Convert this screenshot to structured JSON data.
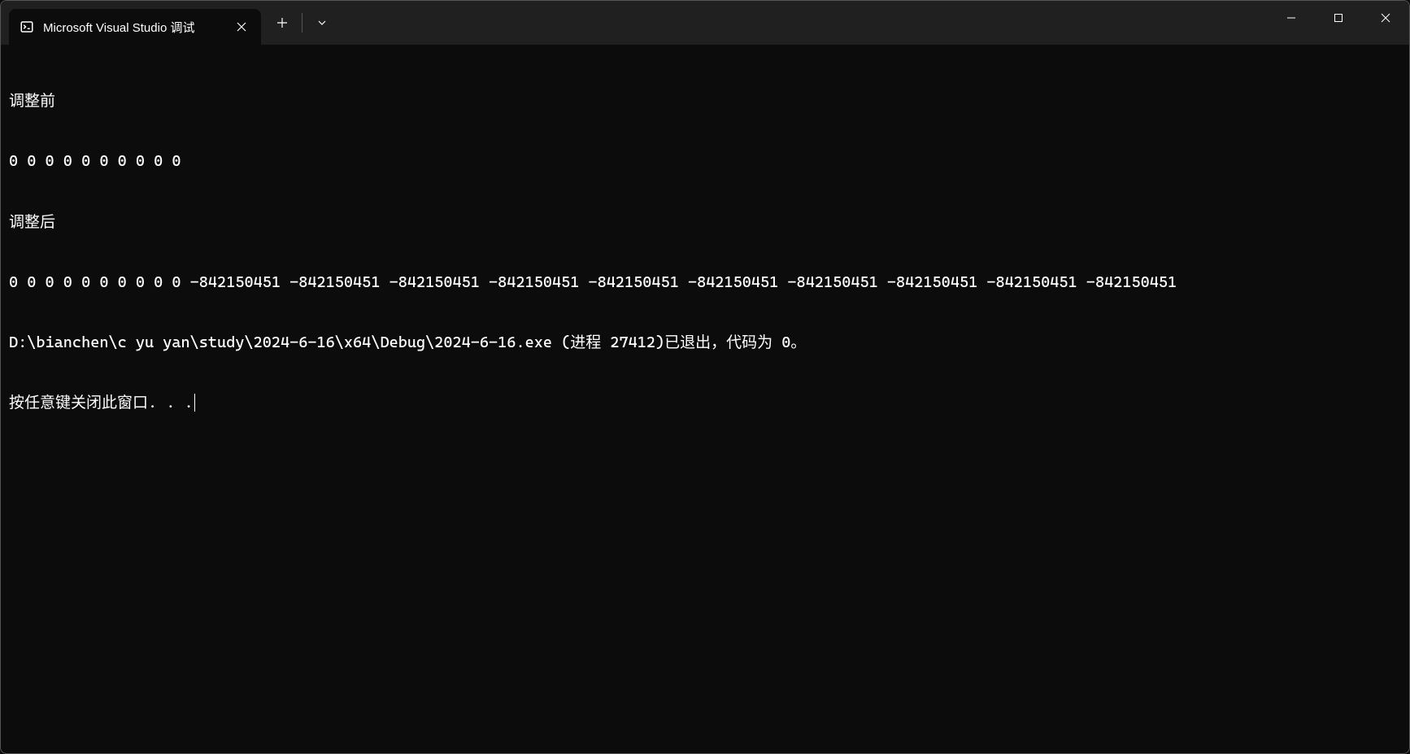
{
  "tab": {
    "title": "Microsoft Visual Studio 调试"
  },
  "output": {
    "line1": "调整前",
    "line2": "0 0 0 0 0 0 0 0 0 0",
    "line3": "调整后",
    "line4": "0 0 0 0 0 0 0 0 0 0 -842150451 -842150451 -842150451 -842150451 -842150451 -842150451 -842150451 -842150451 -842150451 -842150451",
    "line5": "D:\\bianchen\\c yu yan\\study\\2024-6-16\\x64\\Debug\\2024-6-16.exe (进程 27412)已退出，代码为 0。",
    "line6": "按任意键关闭此窗口. . ."
  }
}
